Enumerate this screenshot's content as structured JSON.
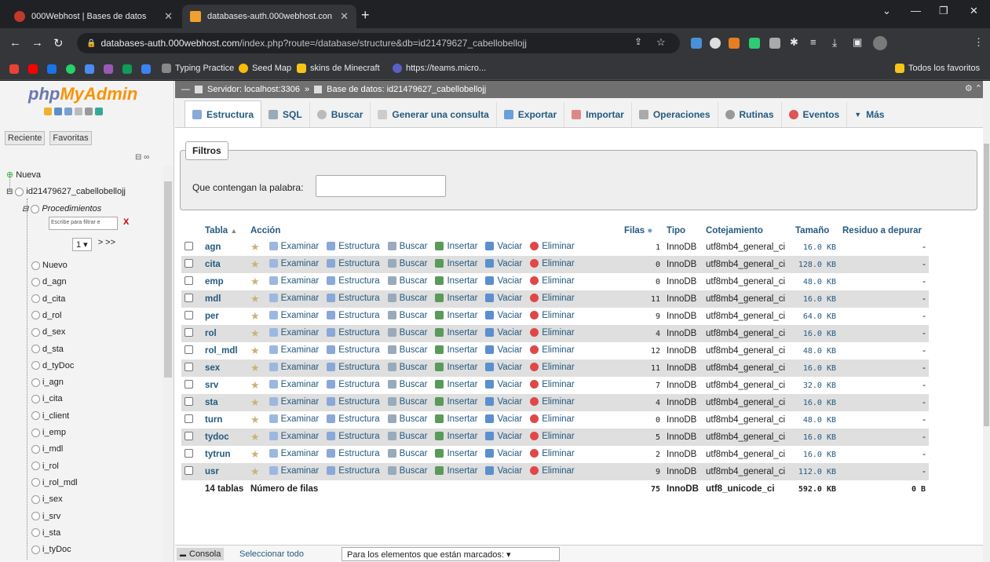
{
  "browser": {
    "tabs": [
      {
        "title": "000Webhost | Bases de datos",
        "active": false
      },
      {
        "title": "databases-auth.000webhost.con",
        "active": true
      }
    ],
    "new_tab": "+",
    "url_host": "databases-auth.000webhost.com",
    "url_path": "/index.php?route=/database/structure&db=id21479627_cabellobellojj",
    "bookmarks": [
      "Typing Practice",
      "Seed Map",
      "skins de Minecraft",
      "https://teams.micro..."
    ],
    "all_bookmarks": "Todos los favoritos"
  },
  "pma": {
    "logo_a": "php",
    "logo_b": "MyAdmin",
    "sidebar_tabs": [
      "Reciente",
      "Favoritas"
    ],
    "tree": {
      "new": "Nueva",
      "db": "id21479627_cabellobellojj",
      "procedures": "Procedimientos",
      "filter_placeholder": "Escribe para filtrar e",
      "filter_clear": "X",
      "page": "1 ▾",
      "page_next": "> >>",
      "items": [
        "Nuevo",
        "d_agn",
        "d_cita",
        "d_rol",
        "d_sex",
        "d_sta",
        "d_tyDoc",
        "i_agn",
        "i_cita",
        "i_client",
        "i_emp",
        "i_mdl",
        "i_rol",
        "i_rol_mdl",
        "i_sex",
        "i_srv",
        "i_sta",
        "i_tyDoc"
      ]
    },
    "breadcrumb": {
      "server": "Servidor: localhost:3306",
      "sep": "»",
      "db": "Base de datos: id21479627_cabellobellojj"
    },
    "menu": [
      {
        "label": "Estructura",
        "active": true
      },
      {
        "label": "SQL",
        "active": false
      },
      {
        "label": "Buscar",
        "active": false
      },
      {
        "label": "Generar una consulta",
        "active": false
      },
      {
        "label": "Exportar",
        "active": false
      },
      {
        "label": "Importar",
        "active": false
      },
      {
        "label": "Operaciones",
        "active": false
      },
      {
        "label": "Rutinas",
        "active": false
      },
      {
        "label": "Eventos",
        "active": false
      },
      {
        "label": "Más",
        "active": false
      }
    ],
    "filters": {
      "legend": "Filtros",
      "label": "Que contengan la palabra:",
      "value": ""
    },
    "table": {
      "headers": [
        "Tabla",
        "Acción",
        "Filas",
        "Tipo",
        "Cotejamiento",
        "Tamaño",
        "Residuo a depurar"
      ],
      "actions": [
        "Examinar",
        "Estructura",
        "Buscar",
        "Insertar",
        "Vaciar",
        "Eliminar"
      ],
      "rows": [
        {
          "name": "agn",
          "rows": "1",
          "type": "InnoDB",
          "collation": "utf8mb4_general_ci",
          "size": "16.0 KB",
          "overhead": "-"
        },
        {
          "name": "cita",
          "rows": "0",
          "type": "InnoDB",
          "collation": "utf8mb4_general_ci",
          "size": "128.0 KB",
          "overhead": "-"
        },
        {
          "name": "emp",
          "rows": "0",
          "type": "InnoDB",
          "collation": "utf8mb4_general_ci",
          "size": "48.0 KB",
          "overhead": "-"
        },
        {
          "name": "mdl",
          "rows": "11",
          "type": "InnoDB",
          "collation": "utf8mb4_general_ci",
          "size": "16.0 KB",
          "overhead": "-"
        },
        {
          "name": "per",
          "rows": "9",
          "type": "InnoDB",
          "collation": "utf8mb4_general_ci",
          "size": "64.0 KB",
          "overhead": "-"
        },
        {
          "name": "rol",
          "rows": "4",
          "type": "InnoDB",
          "collation": "utf8mb4_general_ci",
          "size": "16.0 KB",
          "overhead": "-"
        },
        {
          "name": "rol_mdl",
          "rows": "12",
          "type": "InnoDB",
          "collation": "utf8mb4_general_ci",
          "size": "48.0 KB",
          "overhead": "-"
        },
        {
          "name": "sex",
          "rows": "11",
          "type": "InnoDB",
          "collation": "utf8mb4_general_ci",
          "size": "16.0 KB",
          "overhead": "-"
        },
        {
          "name": "srv",
          "rows": "7",
          "type": "InnoDB",
          "collation": "utf8mb4_general_ci",
          "size": "32.0 KB",
          "overhead": "-"
        },
        {
          "name": "sta",
          "rows": "4",
          "type": "InnoDB",
          "collation": "utf8mb4_general_ci",
          "size": "16.0 KB",
          "overhead": "-"
        },
        {
          "name": "turn",
          "rows": "0",
          "type": "InnoDB",
          "collation": "utf8mb4_general_ci",
          "size": "48.0 KB",
          "overhead": "-"
        },
        {
          "name": "tydoc",
          "rows": "5",
          "type": "InnoDB",
          "collation": "utf8mb4_general_ci",
          "size": "16.0 KB",
          "overhead": "-"
        },
        {
          "name": "tytrun",
          "rows": "2",
          "type": "InnoDB",
          "collation": "utf8mb4_general_ci",
          "size": "16.0 KB",
          "overhead": "-"
        },
        {
          "name": "usr",
          "rows": "9",
          "type": "InnoDB",
          "collation": "utf8mb4_general_ci",
          "size": "112.0 KB",
          "overhead": "-"
        }
      ],
      "footer": {
        "count": "14 tablas",
        "label": "Número de filas",
        "rows": "75",
        "type": "InnoDB",
        "collation": "utf8_unicode_ci",
        "size": "592.0 KB",
        "overhead": "0 B"
      }
    },
    "console": {
      "label": "Consola",
      "select_all": "Seleccionar todo",
      "marked": "Para los elementos que están marcados:  ▾"
    }
  },
  "colors": {
    "link": "#235a81",
    "accent_orange": "#f89406",
    "logo_blue": "#6c78af"
  }
}
